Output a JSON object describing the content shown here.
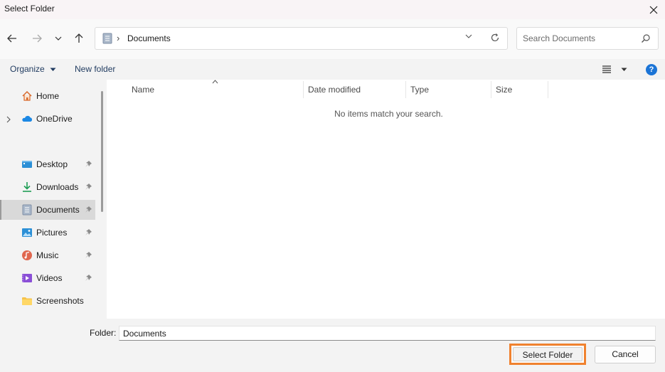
{
  "window": {
    "title": "Select Folder"
  },
  "address_bar": {
    "path": "Documents"
  },
  "search": {
    "placeholder": "Search Documents"
  },
  "toolbar": {
    "organize_label": "Organize",
    "new_folder_label": "New folder"
  },
  "sidebar": {
    "items": [
      {
        "label": "Home",
        "icon": "home-icon"
      },
      {
        "label": "OneDrive",
        "icon": "onedrive-icon"
      },
      {
        "label": "Desktop",
        "icon": "desktop-icon"
      },
      {
        "label": "Downloads",
        "icon": "downloads-icon"
      },
      {
        "label": "Documents",
        "icon": "documents-icon"
      },
      {
        "label": "Pictures",
        "icon": "pictures-icon"
      },
      {
        "label": "Music",
        "icon": "music-icon"
      },
      {
        "label": "Videos",
        "icon": "videos-icon"
      },
      {
        "label": "Screenshots",
        "icon": "screenshots-icon"
      }
    ]
  },
  "file_list": {
    "columns": [
      "Name",
      "Date modified",
      "Type",
      "Size"
    ],
    "empty_message": "No items match your search."
  },
  "footer": {
    "folder_label": "Folder:",
    "folder_value": "Documents",
    "select_label": "Select Folder",
    "cancel_label": "Cancel"
  },
  "colors": {
    "accent": "#1b74d6",
    "highlight": "#f0822f",
    "selected_bg": "#d9d9d9"
  }
}
